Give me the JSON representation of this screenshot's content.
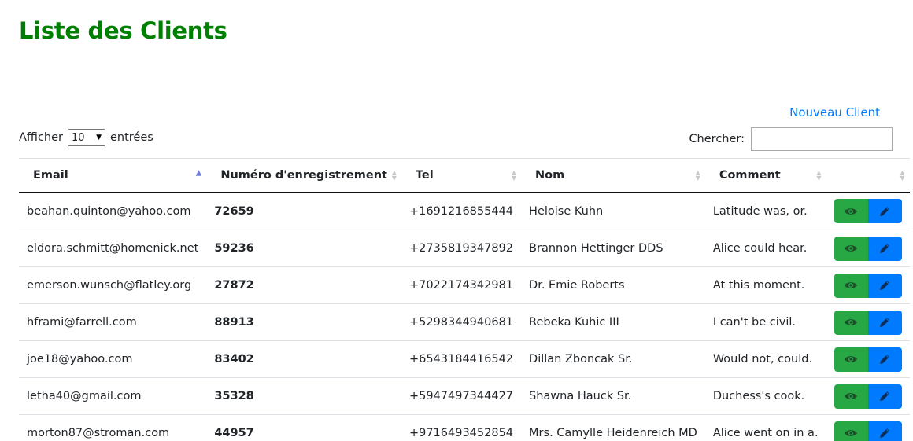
{
  "page": {
    "title": "Liste des Clients",
    "new_client_label": "Nouveau Client"
  },
  "length_control": {
    "prefix": "Afficher",
    "value": "10",
    "suffix": "entrées"
  },
  "search": {
    "label": "Chercher:",
    "value": ""
  },
  "table": {
    "headers": [
      "Email",
      "Numéro d'enregistrement",
      "Tel",
      "Nom",
      "Comment",
      ""
    ],
    "rows": [
      {
        "email": "beahan.quinton@yahoo.com",
        "reg": "72659",
        "tel": "+1691216855444",
        "name": "Heloise Kuhn",
        "comment": "Latitude was, or."
      },
      {
        "email": "eldora.schmitt@homenick.net",
        "reg": "59236",
        "tel": "+2735819347892",
        "name": "Brannon Hettinger DDS",
        "comment": "Alice could hear."
      },
      {
        "email": "emerson.wunsch@flatley.org",
        "reg": "27872",
        "tel": "+7022174342981",
        "name": "Dr. Emie Roberts",
        "comment": "At this moment."
      },
      {
        "email": "hframi@farrell.com",
        "reg": "88913",
        "tel": "+5298344940681",
        "name": "Rebeka Kuhic III",
        "comment": "I can't be civil."
      },
      {
        "email": "joe18@yahoo.com",
        "reg": "83402",
        "tel": "+6543184416542",
        "name": "Dillan Zboncak Sr.",
        "comment": "Would not, could."
      },
      {
        "email": "letha40@gmail.com",
        "reg": "35328",
        "tel": "+5947497344427",
        "name": "Shawna Hauck Sr.",
        "comment": "Duchess's cook."
      },
      {
        "email": "morton87@stroman.com",
        "reg": "44957",
        "tel": "+9716493452854",
        "name": "Mrs. Camylle Heidenreich MD",
        "comment": "Alice went on in a."
      }
    ]
  },
  "colors": {
    "title": "#008000",
    "link": "#007bff",
    "view_button": "#28a745",
    "edit_button": "#007bff"
  },
  "icons": {
    "view": "eye-icon",
    "edit": "pencil-icon",
    "sort_asc": "sort-asc-icon",
    "sort": "sort-both-icon"
  }
}
